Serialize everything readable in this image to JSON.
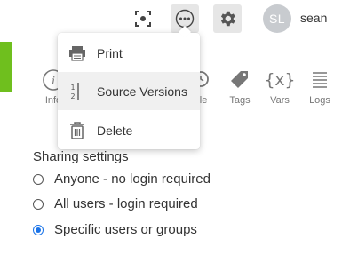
{
  "header": {
    "avatar_initials": "SL",
    "username": "sean",
    "icons": [
      "focus-icon",
      "more-icon",
      "gear-icon"
    ]
  },
  "menu": {
    "items": [
      {
        "label": "Print",
        "icon": "printer-icon"
      },
      {
        "label": "Source Versions",
        "icon": "versions-icon"
      },
      {
        "label": "Delete",
        "icon": "trash-icon"
      }
    ]
  },
  "toolbar": {
    "info_label": "Info",
    "schedule_label": "ule",
    "tags_label": "Tags",
    "vars_label": "Vars",
    "vars_icon_text": "{x}",
    "logs_label": "Logs"
  },
  "sharing": {
    "title": "Sharing settings",
    "options": [
      {
        "label": "Anyone - no login required",
        "checked": false
      },
      {
        "label": "All users - login required",
        "checked": false
      },
      {
        "label": "Specific users or groups",
        "checked": true
      }
    ]
  },
  "colors": {
    "accent_green": "#6fbf1e",
    "radio_blue": "#1a73e8"
  }
}
